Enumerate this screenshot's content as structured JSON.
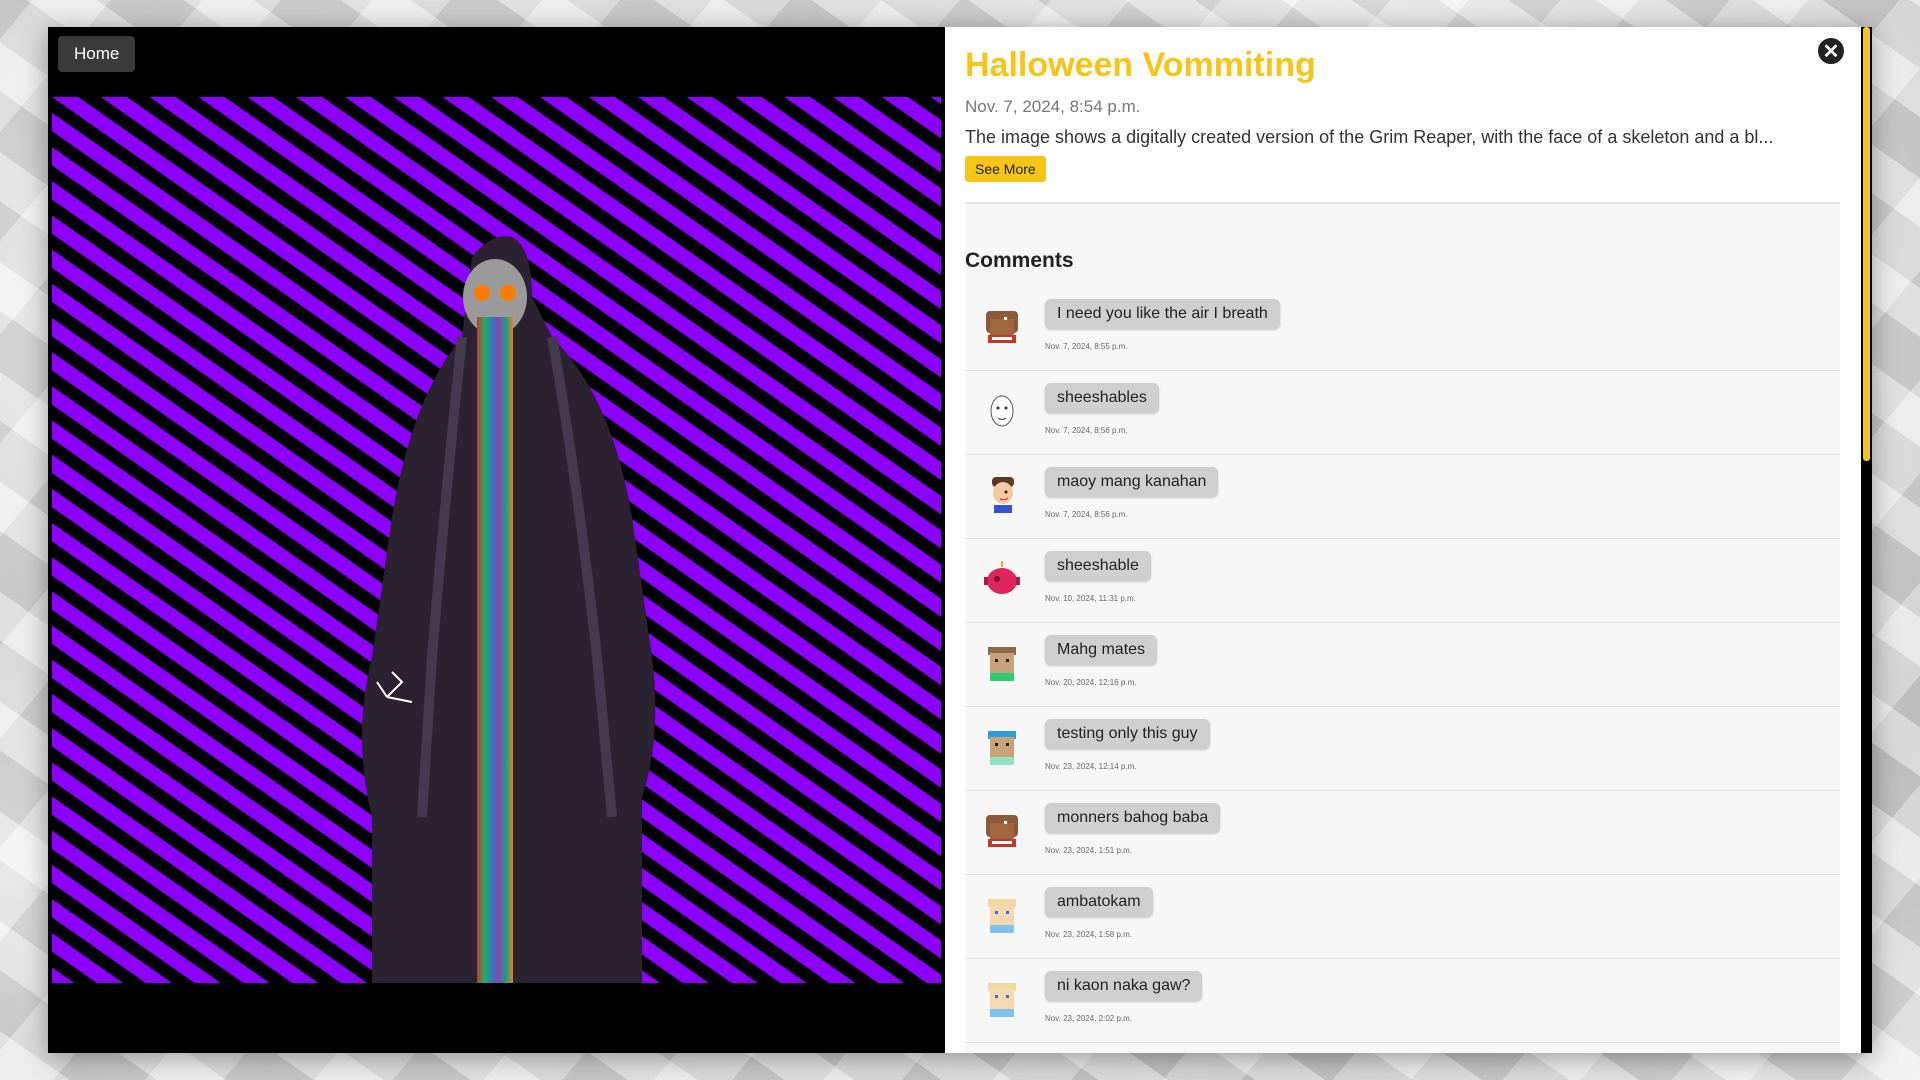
{
  "nav": {
    "home_label": "Home",
    "close_icon": "close-icon",
    "close_glyph": "✕"
  },
  "post": {
    "title": "Halloween Vommiting",
    "date": "Nov. 7, 2024, 8:54 p.m.",
    "description": "The image shows a digitally created version of the Grim Reaper, with the face of a skeleton and a bl...",
    "see_more_label": "See More"
  },
  "comments": {
    "heading": "Comments",
    "items": [
      {
        "text": "I need you like the air I breath",
        "time": "Nov. 7, 2024, 8:55 p.m.",
        "avatar": "pixel-avatar-brown-hat"
      },
      {
        "text": "sheeshables",
        "time": "Nov. 7, 2024, 8:56 p.m.",
        "avatar": "sketch-face-avatar"
      },
      {
        "text": "maoy mang kanahan",
        "time": "Nov. 7, 2024, 8:56 p.m.",
        "avatar": "cartoon-boy-avatar"
      },
      {
        "text": "sheeshable",
        "time": "Nov. 10, 2024, 11:31 p.m.",
        "avatar": "pink-robot-avatar"
      },
      {
        "text": "Mahg mates",
        "time": "Nov. 20, 2024, 12:16 p.m.",
        "avatar": "pixel-avatar-tan-green"
      },
      {
        "text": "testing only this guy",
        "time": "Nov. 23, 2024, 12:14 p.m.",
        "avatar": "pixel-avatar-blue-cap"
      },
      {
        "text": "monners bahog baba",
        "time": "Nov. 23, 2024, 1:51 p.m.",
        "avatar": "pixel-avatar-brown-hat"
      },
      {
        "text": "ambatokam",
        "time": "Nov. 23, 2024, 1:58 p.m.",
        "avatar": "pixel-avatar-blonde"
      },
      {
        "text": "ni kaon naka gaw?",
        "time": "Nov. 23, 2024, 2:02 p.m.",
        "avatar": "pixel-avatar-blonde"
      }
    ]
  },
  "colors": {
    "accent": "#f5c518",
    "artwork_purple": "#8b00ff",
    "artwork_black": "#000000"
  }
}
